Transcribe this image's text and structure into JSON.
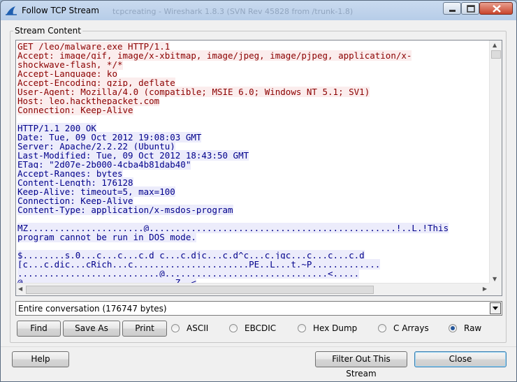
{
  "window": {
    "title": "Follow TCP Stream",
    "background_title": "tcpcreating - Wireshark 1.8.3 (SVN Rev 45828 from /trunk-1.8)"
  },
  "stream_group_label": "Stream Content",
  "stream_lines": [
    {
      "dir": "client",
      "text": "GET /leo/malware.exe HTTP/1.1"
    },
    {
      "dir": "client",
      "text": "Accept: image/gif, image/x-xbitmap, image/jpeg, image/pjpeg, application/x-"
    },
    {
      "dir": "client",
      "text": "shockwave-flash, */*"
    },
    {
      "dir": "client",
      "text": "Accept-Language: ko"
    },
    {
      "dir": "client",
      "text": "Accept-Encoding: gzip, deflate"
    },
    {
      "dir": "client",
      "text": "User-Agent: Mozilla/4.0 (compatible; MSIE 6.0; Windows NT 5.1; SV1)"
    },
    {
      "dir": "client",
      "text": "Host: leo.hackthepacket.com"
    },
    {
      "dir": "client",
      "text": "Connection: Keep-Alive"
    },
    {
      "dir": "blank",
      "text": ""
    },
    {
      "dir": "server",
      "text": "HTTP/1.1 200 OK"
    },
    {
      "dir": "server",
      "text": "Date: Tue, 09 Oct 2012 19:08:03 GMT"
    },
    {
      "dir": "server",
      "text": "Server: Apache/2.2.22 (Ubuntu)"
    },
    {
      "dir": "server",
      "text": "Last-Modified: Tue, 09 Oct 2012 18:43:50 GMT"
    },
    {
      "dir": "server",
      "text": "ETag: \"2d07e-2b000-4cba4b81dab40\""
    },
    {
      "dir": "server",
      "text": "Accept-Ranges: bytes"
    },
    {
      "dir": "server",
      "text": "Content-Length: 176128"
    },
    {
      "dir": "server",
      "text": "Keep-Alive: timeout=5, max=100"
    },
    {
      "dir": "server",
      "text": "Connection: Keep-Alive"
    },
    {
      "dir": "server",
      "text": "Content-Type: application/x-msdos-program"
    },
    {
      "dir": "blank",
      "text": ""
    },
    {
      "dir": "server",
      "text": "MZ......................@...............................................!..L.!This"
    },
    {
      "dir": "server",
      "text": "program cannot be run in DOS mode."
    },
    {
      "dir": "blank",
      "text": ""
    },
    {
      "dir": "server",
      "text": "$........s.0...c...c...c.d_c...c.djc...c.d^c...c.jgc...c...c...c.d"
    },
    {
      "dir": "server",
      "text": "[c...c.dic...cRich...c......................PE..L...t.~P............."
    },
    {
      "dir": "server",
      "text": "...........................@...............................<....."
    },
    {
      "dir": "server",
      "text": "@.............................Z..<"
    }
  ],
  "conversation_select": {
    "value": "Entire conversation (176747 bytes)"
  },
  "buttons": {
    "find": "Find",
    "save_as": "Save As",
    "print": "Print",
    "help": "Help",
    "filter_out": "Filter Out This Stream",
    "close": "Close"
  },
  "formats": [
    {
      "label": "ASCII",
      "selected": false
    },
    {
      "label": "EBCDIC",
      "selected": false
    },
    {
      "label": "Hex Dump",
      "selected": false
    },
    {
      "label": "C Arrays",
      "selected": false
    },
    {
      "label": "Raw",
      "selected": true
    }
  ],
  "colors": {
    "client_text": "#8b0000",
    "client_bg": "#fbeded",
    "server_text": "#00008b",
    "server_bg": "#ececfb"
  },
  "icons": {
    "app": "shark-fin-icon",
    "minimize": "minimize-icon",
    "maximize": "maximize-icon",
    "close": "close-icon"
  }
}
